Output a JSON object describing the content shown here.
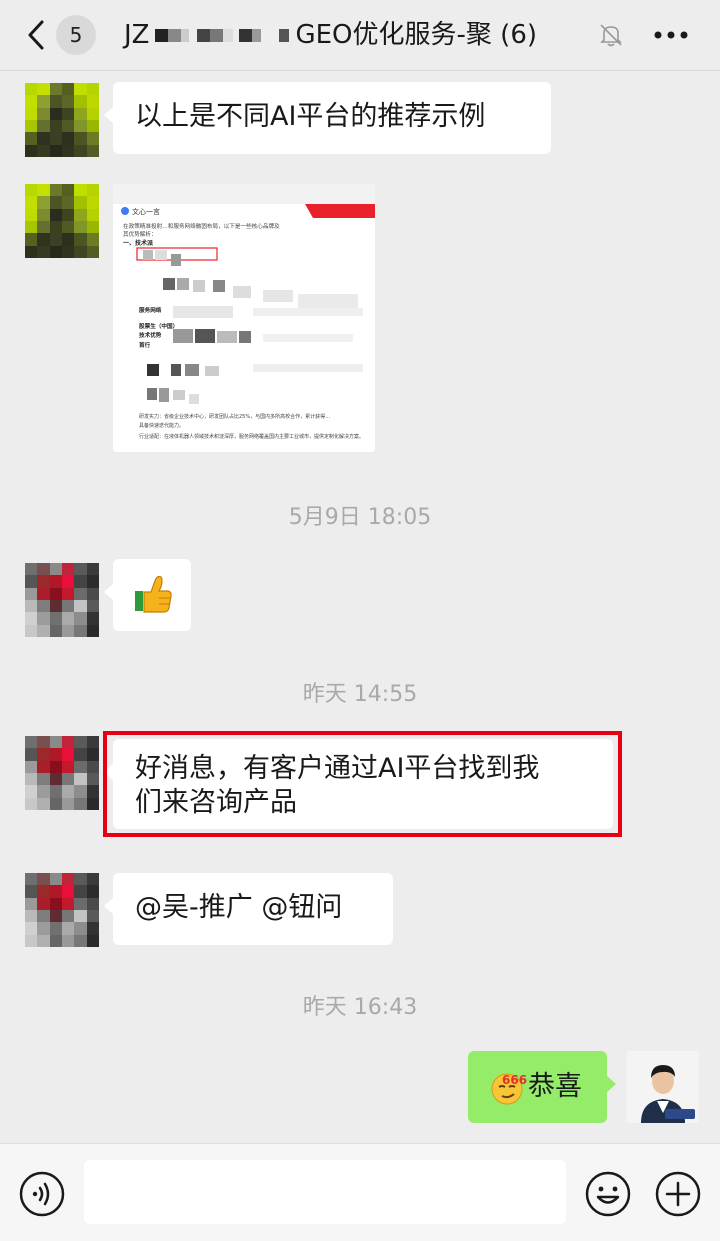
{
  "header": {
    "unread_count": "5",
    "title_prefix": "JZ",
    "title_suffix": "GEO优化服务-聚 (6)"
  },
  "messages": [
    {
      "type": "text",
      "direction": "in",
      "text": "以上是不同AI平台的推荐示例"
    },
    {
      "type": "image",
      "direction": "in",
      "image": {
        "brand": "文心一言",
        "lines": [
          "在政策精准投射…和服务网络融固布局，以下是一些核心品牌及",
          "其优势解析：",
          "一、技术派",
          "服务网络",
          "股票生（中国）",
          "技术优势",
          "首行",
          "研发实力：省级企业技术中心，研发团队占比25%，与国内多所高校合作，累计获得…",
          "具备快速迭代能力。",
          "行业适配：在液体机器人领域技术积淀深厚，服务网络覆盖国内主要工业城市，提供定制化解决方案。"
        ]
      }
    },
    {
      "type": "timestamp",
      "text": "5月9日 18:05"
    },
    {
      "type": "sticker",
      "direction": "in",
      "name": "thumbs-up"
    },
    {
      "type": "timestamp",
      "text": "昨天 14:55"
    },
    {
      "type": "text",
      "direction": "in",
      "text_line1": "好消息，有客户通过AI平台找到我",
      "text_line2": "们来咨询产品",
      "highlighted": true
    },
    {
      "type": "text",
      "direction": "in",
      "text": "@吴-推广 @钮问"
    },
    {
      "type": "timestamp",
      "text": "昨天 16:43"
    },
    {
      "type": "text",
      "direction": "out",
      "emoji": "666",
      "text": "恭喜"
    }
  ],
  "input": {
    "placeholder": ""
  },
  "colors": {
    "highlight": "#e60012",
    "outgoing_bubble": "#95ec69",
    "background": "#ededed"
  },
  "icons": [
    "back-icon",
    "mute-bell-icon",
    "more-icon",
    "voice-icon",
    "emoji-icon",
    "plus-icon"
  ]
}
